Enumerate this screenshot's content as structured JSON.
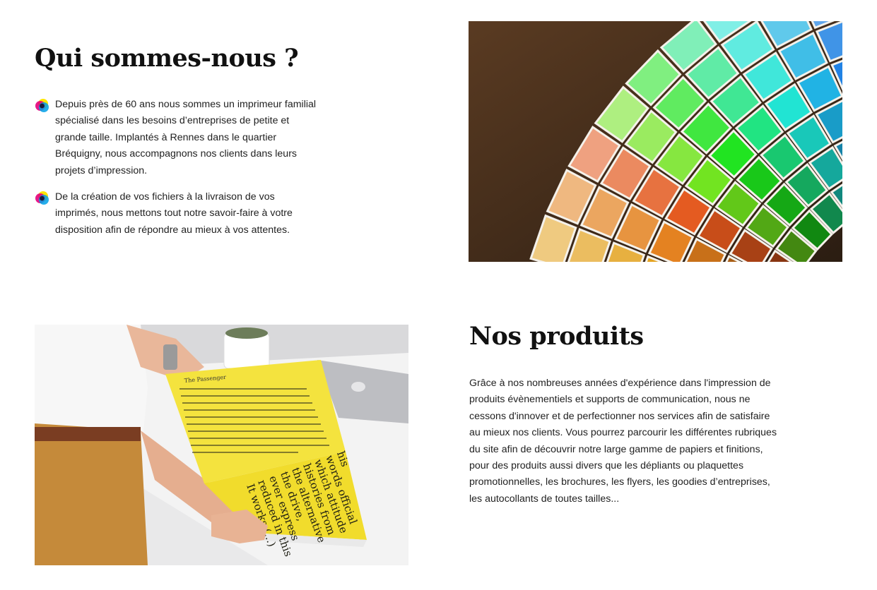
{
  "about": {
    "title": "Qui sommes-nous ?",
    "bullets": [
      "Depuis près de 60 ans nous sommes un imprimeur familial spécialisé dans les besoins d’entreprises de petite et grande taille. Implantés à Rennes dans le quartier Bréquigny, nous accompagnons nos clients dans leurs projets d’impression.",
      "De la création de vos fichiers à la livraison de vos imprimés, nous mettons tout notre savoir-faire à votre disposition afin de répondre au mieux à vos attentes."
    ],
    "bullet_icon": "cmyk-dots-icon",
    "photo": "pantone-color-swatches"
  },
  "products": {
    "title": "Nos produits",
    "text": "Grâce à nos nombreuses années d'expérience dans l'impression de produits évènementiels et supports de communication, nous ne cessons d'innover et de perfectionner nos services afin de satisfaire au mieux nos clients. Vous pourrez parcourir les différentes rubriques du site afin de découvrir notre large gamme de papiers et finitions, pour des produits aussi divers que les dépliants ou plaquettes promotionnelles, les brochures, les flyers, les goodies d’entreprises, les autocollants de toutes tailles...",
    "photo": "person-reading-yellow-magazine",
    "photo_text": [
      "The Passenger",
      "It works (...)",
      "reduced in this",
      "ever express",
      "the drive,",
      "the alternative",
      "histories from",
      "which attitude",
      "words official",
      "his"
    ]
  },
  "colors": {
    "heading": "#111111",
    "text": "#222222",
    "cyan": "#00a0e6",
    "magenta": "#e4007c",
    "yellow": "#ffe600",
    "paper_yellow": "#f4e33e"
  }
}
